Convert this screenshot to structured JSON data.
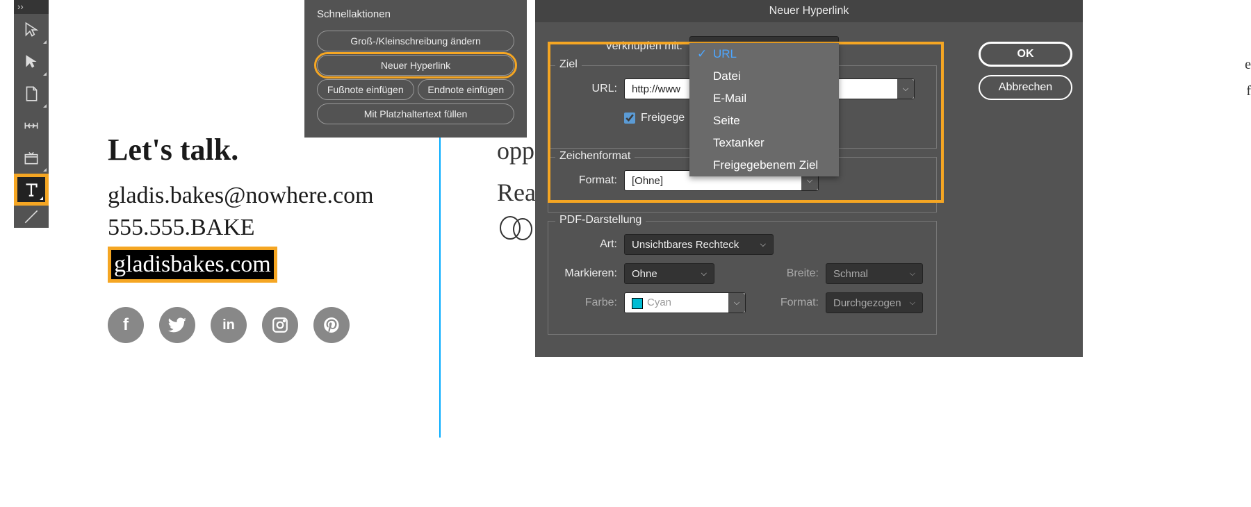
{
  "toolbar": {
    "collapse": "››"
  },
  "document": {
    "heading": "Let's talk.",
    "email": "gladis.bakes@nowhere.com",
    "phone": "555.555.BAKE",
    "selected": "gladisbakes.com",
    "bg1": "opp",
    "bg2": "Rea"
  },
  "quick_actions": {
    "title": "Schnellaktionen",
    "change_case": "Groß-/Kleinschreibung ändern",
    "new_hyperlink": "Neuer Hyperlink",
    "footnote": "Fußnote einfügen",
    "endnote": "Endnote einfügen",
    "placeholder": "Mit Platzhaltertext füllen"
  },
  "dialog": {
    "title": "Neuer Hyperlink",
    "link_to_label": "Verknüpfen mit:",
    "link_to_value": "URL",
    "options": [
      "URL",
      "Datei",
      "E-Mail",
      "Seite",
      "Textanker",
      "Freigegebenem Ziel"
    ],
    "ziel_legend": "Ziel",
    "url_label": "URL:",
    "url_value": "http://www",
    "shared_label": "Freigege",
    "char_legend": "Zeichenformat",
    "format_label": "Format:",
    "format_value": "[Ohne]",
    "pdf_legend": "PDF-Darstellung",
    "art_label": "Art:",
    "art_value": "Unsichtbares Rechteck",
    "mark_label": "Markieren:",
    "mark_value": "Ohne",
    "width_label": "Breite:",
    "width_value": "Schmal",
    "color_label": "Farbe:",
    "color_value": "Cyan",
    "style_label": "Format:",
    "style_value": "Durchgezogen",
    "ok": "OK",
    "cancel": "Abbrechen"
  },
  "sidetext": {
    "a": "e",
    "b": "f"
  }
}
